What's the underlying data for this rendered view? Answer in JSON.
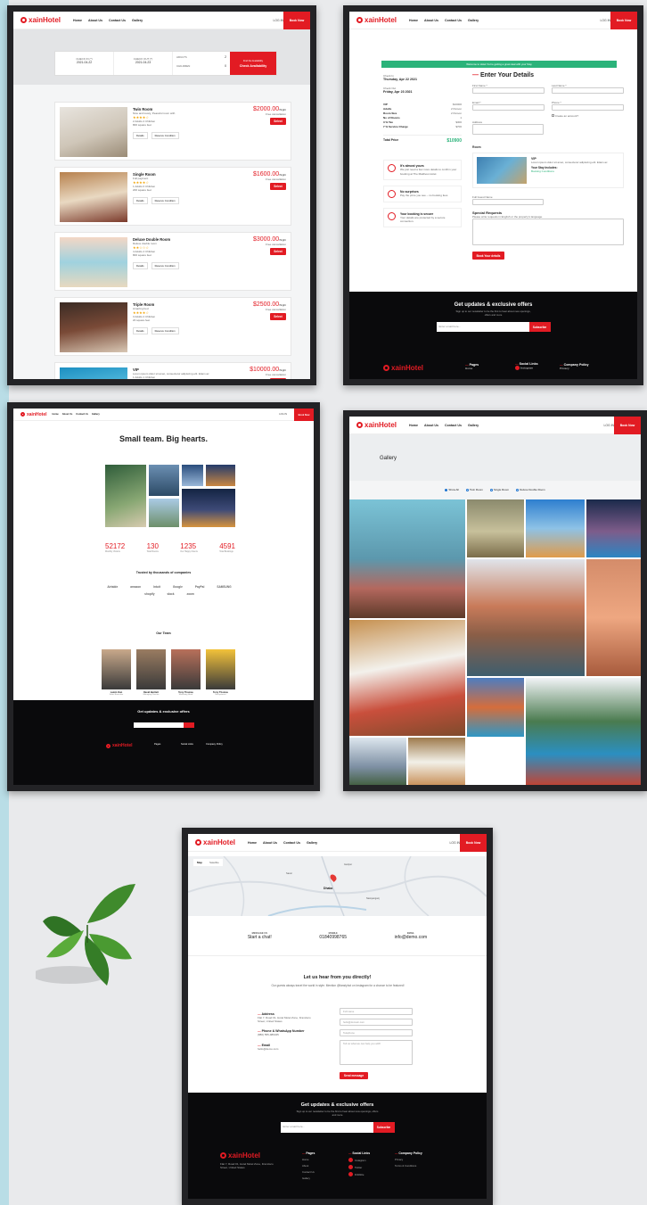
{
  "site": {
    "logo": "xainHotel",
    "nav": [
      "Home",
      "About Us",
      "Contact Us",
      "Gallery"
    ],
    "login": "LOG IN",
    "book_now": "Book Now"
  },
  "rooms_page": {
    "search": [
      {
        "label": "CHECK IN (*)",
        "value": "2021-04-22"
      },
      {
        "label": "CHECK OUT (*)",
        "value": "2021-04-23"
      }
    ],
    "guests": [
      {
        "label": "ADULTS",
        "value": "2"
      },
      {
        "label": "CHILDREN",
        "value": "0"
      }
    ],
    "find_label": "Find the Availability",
    "check_button": "Check Availability",
    "rooms": [
      {
        "name": "Twin Room",
        "desc": "Nice and lovely, Peaceful room with",
        "stars": "★★★★☆",
        "capacity": "2 Adults 2 Children",
        "area": "800 square feet",
        "price": "$2000.00",
        "unit": "/Night",
        "note": "Free cancellation",
        "select": "Select",
        "details": "Details",
        "reserve": "Reserve Condition"
      },
      {
        "name": "Single Room",
        "desc": "Full payment",
        "stars": "★★★★☆",
        "capacity": "1 Adults 0 Children",
        "area": "200 square feet",
        "price": "$1600.00",
        "unit": "/Night",
        "note": "Free cancellation",
        "select": "Select",
        "details": "Details",
        "reserve": "Reserve Condition"
      },
      {
        "name": "Deluxe Double Room",
        "desc": "Deluxe double room",
        "stars": "★★☆☆☆",
        "capacity": "4 Adults 4 Children",
        "area": "800 square feet",
        "price": "$3000.00",
        "unit": "/Night",
        "note": "Free cancellation",
        "select": "Select",
        "details": "Details",
        "reserve": "Reserve Condition"
      },
      {
        "name": "Triple Room",
        "desc": "Amazing bed",
        "stars": "★★★★☆",
        "capacity": "3 Adults 2 Children",
        "area": "20 square feet",
        "price": "$2500.00",
        "unit": "/Night",
        "note": "Free cancellation",
        "select": "Select",
        "details": "Details",
        "reserve": "Reserve Condition"
      },
      {
        "name": "VIP",
        "desc": "Lorem ipsum dolor sit amet, consectetur adipiscing elit. Etiam ac",
        "stars": "",
        "capacity": "1 Adults 1 Children",
        "area": "",
        "price": "$10000.00",
        "unit": "/Night",
        "note": "Free cancellation",
        "select": "Select",
        "details": "",
        "reserve": ""
      }
    ]
  },
  "booking_page": {
    "banner": "Welcome to Hotel You're getting a great deal with your Stay",
    "checkin_label": "Check In",
    "checkin_date": "Thursday, Apr 22 2021",
    "checkout_label": "Check Out",
    "checkout_date": "Friday, Apr 23 2021",
    "summary": [
      {
        "k": "VIP",
        "v": "$10000"
      },
      {
        "k": "Adults",
        "v": "2 Person"
      },
      {
        "k": "Room Size",
        "v": "2 Person"
      },
      {
        "k": "No of Rooms",
        "v": "1"
      },
      {
        "k": "3 % Tax",
        "v": "$300"
      },
      {
        "k": "7 % Service Charge",
        "v": "$700"
      }
    ],
    "total_label": "Total Price",
    "total": "$10900",
    "perks": [
      {
        "title": "It's almost yours",
        "text": "We just need a few more details to confirm your booking at The Maldives Hotel."
      },
      {
        "title": "No surprises",
        "text": "Pay the price you see – no booking fees"
      },
      {
        "title": "Your booking is secure",
        "text": "Your details are protected by a secure connection."
      }
    ],
    "heading": "Enter Your Details",
    "first_name": "First Name *",
    "last_name": "Last Name *",
    "email": "Email *",
    "phone": "Phone *",
    "address": "Address",
    "create_account": "Create an account?",
    "room_label": "Room",
    "room_name": "VIP",
    "room_desc": "Lorem ipsum dolor sit amet, consectetur adipiscing elit. Etiam ac",
    "stay_includes": "Your Stay Includes:",
    "booking_conditions": "Booking Conditions",
    "guest_name": "Full Guest Name",
    "special_requests": "Special Requests",
    "special_note": "Please write requests in English or the property's language.",
    "book_button": "Book Your details",
    "footer_title": "Get updates & exclusive offers",
    "footer_sub": "Sign up to our newsletter to be the first to hear about new openings, offers and more",
    "footer_placeholder": "Enter email here...",
    "footer_subscribe": "Subscribe",
    "footer_cols": [
      "Pages",
      "Social Links",
      "Company Policy"
    ],
    "footer_items": [
      "Home",
      "Instagram",
      "Privacy"
    ]
  },
  "about_page": {
    "title": "Small team. Big hearts.",
    "stats": [
      {
        "value": "52172",
        "label": "Monthly Visitors"
      },
      {
        "value": "130",
        "label": "Total Rooms"
      },
      {
        "value": "1235",
        "label": "Our Happy Clients"
      },
      {
        "value": "4591",
        "label": "Total Bookings"
      }
    ],
    "trusted": "Trusted by thousands of companies",
    "brands": [
      "Airtable",
      "amazon",
      "Intuit",
      "Google",
      "PayPal",
      "SAMSUNG",
      "shopify",
      "slack",
      "zoom"
    ],
    "team_title": "Our Team",
    "team": [
      {
        "name": "Lamin Oun",
        "role": "Sales Executive"
      },
      {
        "name": "David Bertlett",
        "role": "Managing Director"
      },
      {
        "name": "Tony Thomas",
        "role": "Marketing Head"
      },
      {
        "name": "Terry Thomas",
        "role": "Receptionist"
      }
    ],
    "footer_title": "Get updates & exclusive offers",
    "footer_cols": [
      "Pages",
      "Social Links",
      "Company Policy"
    ]
  },
  "gallery_page": {
    "title": "Gallery",
    "filters": [
      "Show All",
      "Twin Room",
      "Single Room",
      "Deluxe Double Room"
    ],
    "selected": "Show All"
  },
  "contact_page": {
    "map_tabs": [
      "Map",
      "Satellite"
    ],
    "map_places": [
      "Dhaka",
      "Narayanganj",
      "Gazipur",
      "Savar"
    ],
    "contacts": [
      {
        "label": "MESSAGE US",
        "value": "Start a chat!"
      },
      {
        "label": "MOBILE",
        "value": "01840998765"
      },
      {
        "label": "EMAIL",
        "value": "info@demo.com"
      }
    ],
    "heading": "Let us hear from you directly!",
    "subtext": "Our guests always travel the world in style. Mention @fanstyhot on Instagram for a chance to be featured!",
    "info": [
      {
        "title": "Address",
        "text": "Flat 7, Road 01, Hotel Motel Zone, Francisco Street, United States"
      },
      {
        "title": "Phone & WhatsApp Number",
        "text": "(880) 555-989345"
      },
      {
        "title": "Email",
        "text": "hello@demo.com"
      }
    ],
    "form": {
      "name": "Full name",
      "email": "hello@domain.com",
      "phone": "Telephone",
      "message": "Tell us what we can help you with!",
      "send": "Send message"
    },
    "footer_title": "Get updates & exclusive offers",
    "footer_sub": "Sign up to our newsletter to be the first to hear about new openings, offers and more",
    "footer_placeholder": "Enter email here...",
    "footer_subscribe": "Subscribe",
    "footer_cols": [
      "Pages",
      "Social Links",
      "Company Policy"
    ],
    "footer_pages": [
      "Home",
      "About",
      "Contact Us",
      "Gallery"
    ],
    "footer_social": [
      "Instagram",
      "Twitter",
      "Dribbble"
    ],
    "footer_policy": [
      "Privacy",
      "Terms & Conditions"
    ],
    "footer_address": "Flat 7, Road 01, Hotel Motel Zone, Francisco Street, United States"
  }
}
